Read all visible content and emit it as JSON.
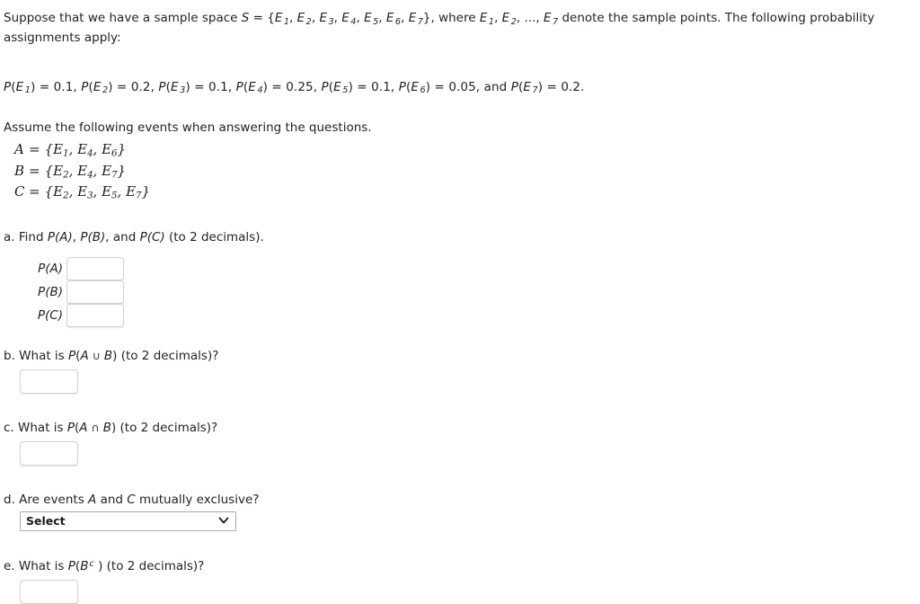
{
  "document": {
    "intro_prefix": "Suppose that we have a sample space ",
    "intro_S": "S",
    "intro_eq": " = {",
    "intro_E": "E",
    "intro_close": "}, where ",
    "intro_mid": " denote the sample points. The following probability assignments apply:",
    "intro_line2": "assignments apply:",
    "sample_point_indices": [
      "1",
      "2",
      "3",
      "4",
      "5",
      "6",
      "7"
    ],
    "ellipsis": "...,",
    "assume_line": "Assume the following events when answering the questions."
  },
  "probabilities": {
    "line": "P(E 1) = 0.1, P(E 2) = 0.2, P(E 3) = 0.1, P(E 4) = 0.25, P(E 5) = 0.1, P(E 6) = 0.05, and P(E 7) = 0.2.",
    "items": [
      {
        "index": "1",
        "value": "0.1"
      },
      {
        "index": "2",
        "value": "0.2"
      },
      {
        "index": "3",
        "value": "0.1"
      },
      {
        "index": "4",
        "value": "0.25"
      },
      {
        "index": "5",
        "value": "0.1"
      },
      {
        "index": "6",
        "value": "0.05"
      },
      {
        "index": "7",
        "value": "0.2"
      }
    ],
    "and_word": "and",
    "P_symbol": "P",
    "E_symbol": "E"
  },
  "events": [
    {
      "name": "A",
      "elements": [
        "1",
        "4",
        "6"
      ]
    },
    {
      "name": "B",
      "elements": [
        "2",
        "4",
        "7"
      ]
    },
    {
      "name": "C",
      "elements": [
        "2",
        "3",
        "5",
        "7"
      ]
    }
  ],
  "questions": {
    "a": {
      "marker": "a.",
      "text_before": "Find ",
      "text_after": " (to 2 decimals).",
      "terms": [
        "P(A)",
        "P(B)",
        "P(C)"
      ],
      "joiner1": ", ",
      "joiner2": ", and ",
      "rows": [
        {
          "label_P": "P",
          "label_arg": "(A)",
          "value": "",
          "placeholder": ""
        },
        {
          "label_P": "P",
          "label_arg": "(B)",
          "value": "",
          "placeholder": ""
        },
        {
          "label_P": "P",
          "label_arg": "(C)",
          "value": "",
          "placeholder": ""
        }
      ]
    },
    "b": {
      "marker": "b.",
      "text": "What is P(A ∪ B) (to 2 decimals)?",
      "prefix": "What is ",
      "P": "P",
      "open": "(",
      "left_set": "A",
      "operator": "∪",
      "right_set": "B",
      "close": ")",
      "suffix": " (to 2 decimals)?",
      "value": "",
      "placeholder": ""
    },
    "c": {
      "marker": "c.",
      "text": "What is P(A ∩ B) (to 2 decimals)?",
      "prefix": "What is ",
      "P": "P",
      "open": "(",
      "left_set": "A",
      "operator": "∩",
      "right_set": "B",
      "close": ")",
      "suffix": " (to 2 decimals)?",
      "value": "",
      "placeholder": ""
    },
    "d": {
      "marker": "d.",
      "prefix": "Are events ",
      "set1": "A",
      "conj": " and ",
      "set2": "C",
      "suffix": " mutually exclusive?",
      "select_value": "Select",
      "select_options": [
        "Select"
      ]
    },
    "e": {
      "marker": "e.",
      "prefix": "What is ",
      "P": "P",
      "open": "(",
      "set": "B",
      "superscript": "c",
      "close": " )",
      "suffix": " (to 2 decimals)?",
      "value": "",
      "placeholder": ""
    }
  },
  "colors": {
    "text": "#231f20",
    "input_border": "#d2d2d2",
    "select_border": "#a9a9a9",
    "background": "#ffffff"
  }
}
